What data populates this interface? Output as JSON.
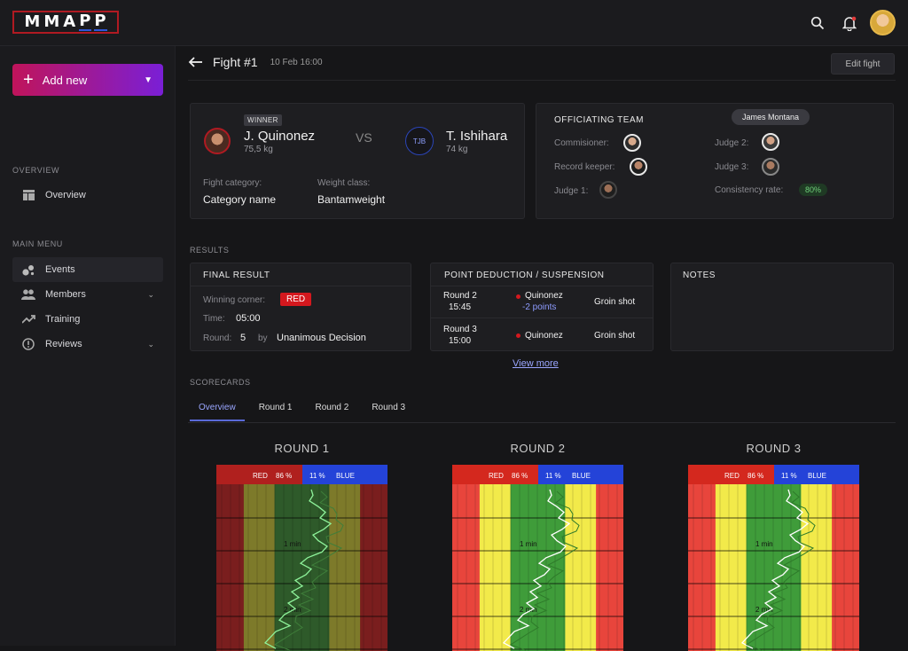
{
  "app": {
    "logo": [
      "M",
      "M",
      "A",
      "P",
      "P"
    ]
  },
  "topbar": {
    "search_icon": "search-icon",
    "bell_icon": "bell-icon",
    "notification_dot_color": "#e23b3b"
  },
  "sidebar": {
    "add_new_label": "Add new",
    "overview_section": "OVERVIEW",
    "overview_item": "Overview",
    "main_menu_section": "MAIN MENU",
    "items": [
      {
        "label": "Events",
        "icon": "events-icon"
      },
      {
        "label": "Members",
        "icon": "members-icon"
      },
      {
        "label": "Training",
        "icon": "trending-icon"
      },
      {
        "label": "Reviews",
        "icon": "alert-icon"
      }
    ]
  },
  "fight": {
    "title": "Fight #1",
    "date": "10 Feb 16:00",
    "edit_label": "Edit fight",
    "winner_badge": "WINNER",
    "red_name": "J. Quinonez",
    "red_weight": "75,5 kg",
    "vs": "VS",
    "blue_initials": "TJB",
    "blue_name": "T. Ishihara",
    "blue_weight": "74 kg",
    "category_label": "Fight category:",
    "category_value": "Category name",
    "weight_label": "Weight class:",
    "weight_value": "Bantamweight"
  },
  "officiating": {
    "title": "OFFICIATING TEAM",
    "tooltip": "James Montana",
    "commisioner_label": "Commisioner:",
    "record_keeper_label": "Record keeper:",
    "judge1_label": "Judge 1:",
    "judge2_label": "Judge 2:",
    "judge3_label": "Judge 3:",
    "consistency_label": "Consistency rate:",
    "consistency_value": "80%"
  },
  "results": {
    "section_label": "RESULTS",
    "final_title": "FINAL RESULT",
    "winning_corner_label": "Winning corner:",
    "winning_corner_value": "RED",
    "time_label": "Time:",
    "time_value": "05:00",
    "round_label": "Round:",
    "round_value": "5",
    "by_label": "by",
    "decision": "Unanimous Decision",
    "deduction_title": "POINT DEDUCTION / SUSPENSION",
    "deductions": [
      {
        "round": "Round 2",
        "time": "15:45",
        "fighter": "Quinonez",
        "points": "-2 points",
        "reason": "Groin shot"
      },
      {
        "round": "Round 3",
        "time": "15:00",
        "fighter": "Quinonez",
        "points": "",
        "reason": "Groin shot"
      }
    ],
    "view_more": "View more",
    "notes_title": "NOTES"
  },
  "scorecards": {
    "section_label": "SCORECARDS",
    "tabs": [
      "Overview",
      "Round 1",
      "Round 2",
      "Round 3"
    ],
    "active_tab": "Overview",
    "rounds": [
      {
        "title": "ROUND 1",
        "red_label": "RED",
        "red_pct": "86 %",
        "blue_pct": "11 %",
        "blue_label": "BLUE",
        "marks": [
          "1 min",
          "2 min"
        ],
        "muted": true
      },
      {
        "title": "ROUND 2",
        "red_label": "RED",
        "red_pct": "86 %",
        "blue_pct": "11 %",
        "blue_label": "BLUE",
        "marks": [
          "1 min",
          "2 min"
        ],
        "muted": false
      },
      {
        "title": "ROUND 3",
        "red_label": "RED",
        "red_pct": "86 %",
        "blue_pct": "11 %",
        "blue_label": "BLUE",
        "marks": [
          "1 min",
          "2 min"
        ],
        "muted": false
      }
    ]
  }
}
